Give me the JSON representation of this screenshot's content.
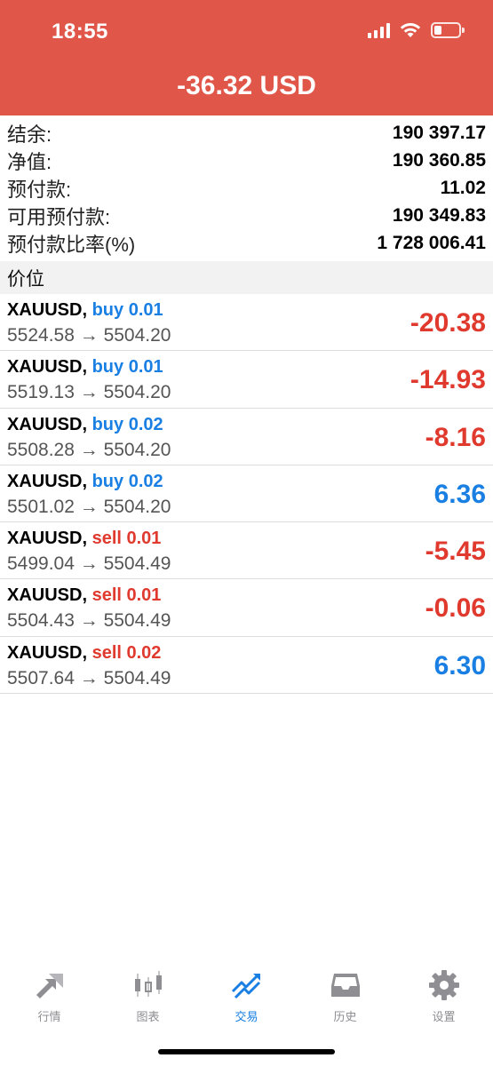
{
  "status_bar": {
    "time": "18:55"
  },
  "header": {
    "total_profit": "-36.32 USD"
  },
  "summary": [
    {
      "label": "结余:",
      "value": "190 397.17"
    },
    {
      "label": "净值:",
      "value": "190 360.85"
    },
    {
      "label": "预付款:",
      "value": "11.02"
    },
    {
      "label": "可用预付款:",
      "value": "190 349.83"
    },
    {
      "label": "预付款比率(%)",
      "value": "1 728 006.41"
    }
  ],
  "section_title": "价位",
  "positions": [
    {
      "symbol": "XAUUSD,",
      "type": "buy",
      "volume": "buy 0.01",
      "prices": "5524.58 → 5504.20",
      "profit": "-20.38"
    },
    {
      "symbol": "XAUUSD,",
      "type": "buy",
      "volume": "buy 0.01",
      "prices": "5519.13 → 5504.20",
      "profit": "-14.93"
    },
    {
      "symbol": "XAUUSD,",
      "type": "buy",
      "volume": "buy 0.02",
      "prices": "5508.28 → 5504.20",
      "profit": "-8.16"
    },
    {
      "symbol": "XAUUSD,",
      "type": "buy",
      "volume": "buy 0.02",
      "prices": "5501.02 → 5504.20",
      "profit": "6.36"
    },
    {
      "symbol": "XAUUSD,",
      "type": "sell",
      "volume": "sell 0.01",
      "prices": "5499.04 → 5504.49",
      "profit": "-5.45"
    },
    {
      "symbol": "XAUUSD,",
      "type": "sell",
      "volume": "sell 0.01",
      "prices": "5504.43 → 5504.49",
      "profit": "-0.06"
    },
    {
      "symbol": "XAUUSD,",
      "type": "sell",
      "volume": "sell 0.02",
      "prices": "5507.64 → 5504.49",
      "profit": "6.30"
    }
  ],
  "tabs": [
    {
      "label": "行情",
      "icon": "quotes-arrows-icon",
      "active": false
    },
    {
      "label": "图表",
      "icon": "candlestick-chart-icon",
      "active": false
    },
    {
      "label": "交易",
      "icon": "trade-trend-icon",
      "active": true
    },
    {
      "label": "历史",
      "icon": "history-inbox-icon",
      "active": false
    },
    {
      "label": "设置",
      "icon": "gear-icon",
      "active": false
    }
  ],
  "colors": {
    "header_bg": "#e0574a",
    "buy": "#1a7fe3",
    "sell": "#e03a2f",
    "profit_positive": "#1a7fe3",
    "profit_negative": "#e03a2f",
    "tab_active": "#1a7fe3",
    "tab_inactive": "#8e8e93"
  }
}
